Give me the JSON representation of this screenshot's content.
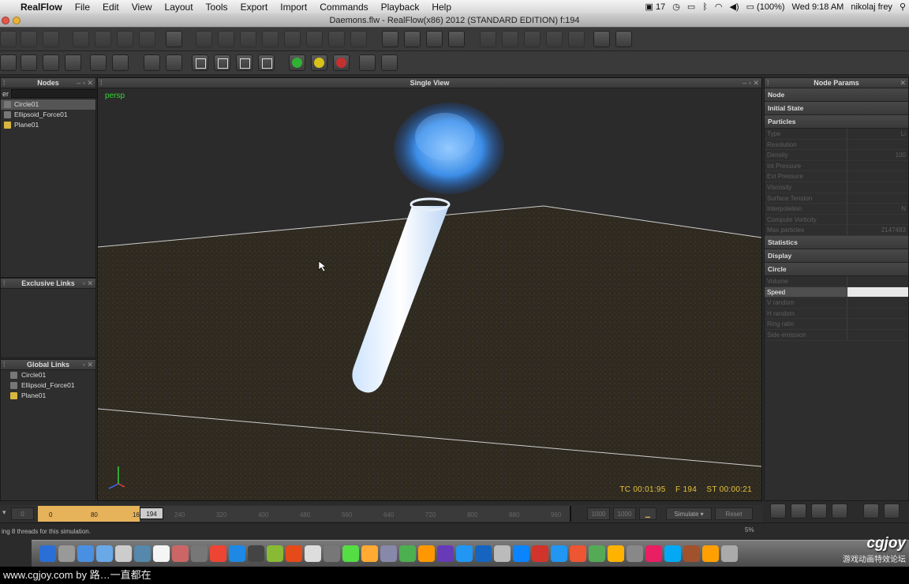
{
  "menubar": {
    "app_name": "RealFlow",
    "items": [
      "File",
      "Edit",
      "View",
      "Layout",
      "Tools",
      "Export",
      "Import",
      "Commands",
      "Playback",
      "Help"
    ],
    "status_badge": "17",
    "battery": "(100%)",
    "clock": "Wed 9:18 AM",
    "user": "nikolaj frey"
  },
  "window": {
    "title": "Daemons.flw - RealFlow(x86) 2012 (STANDARD EDITION) f:194"
  },
  "nodes_panel": {
    "title": "Nodes",
    "search_label": "er",
    "items": [
      {
        "label": "Circle01",
        "icon": "emitter-icon",
        "selected": true
      },
      {
        "label": "Ellipsoid_Force01",
        "icon": "daemon-icon",
        "selected": false
      },
      {
        "label": "Plane01",
        "icon": "object-icon",
        "selected": false
      }
    ]
  },
  "exclusive_links": {
    "title": "Exclusive Links"
  },
  "global_links": {
    "title": "Global Links",
    "items": [
      {
        "label": "Circle01",
        "icon": "emitter-icon"
      },
      {
        "label": "Ellipsoid_Force01",
        "icon": "daemon-icon"
      },
      {
        "label": "Plane01",
        "icon": "object-icon"
      }
    ]
  },
  "viewport": {
    "title": "Single View",
    "camera": "persp",
    "timecode": "TC 00:01:95",
    "frame": "F 194",
    "sim_time": "ST 00:00:21"
  },
  "params": {
    "title": "Node Params",
    "sections": {
      "node": "Node",
      "initial_state": "Initial State",
      "particles": "Particles",
      "statistics": "Statistics",
      "display": "Display",
      "circle": "Circle"
    },
    "particle_rows": [
      {
        "k": "Type",
        "v": "Li"
      },
      {
        "k": "Resolution",
        "v": ""
      },
      {
        "k": "Density",
        "v": "100"
      },
      {
        "k": "Int Pressure",
        "v": ""
      },
      {
        "k": "Ext Pressure",
        "v": ""
      },
      {
        "k": "Viscosity",
        "v": ""
      },
      {
        "k": "Surface Tension",
        "v": ""
      },
      {
        "k": "Interpolation",
        "v": "N"
      },
      {
        "k": "Compute Vorticity",
        "v": ""
      },
      {
        "k": "Max particles",
        "v": "2147483"
      }
    ],
    "circle_rows": [
      {
        "k": "Volume",
        "v": "",
        "selected": false
      },
      {
        "k": "Speed",
        "v": "",
        "selected": true
      },
      {
        "k": "V random",
        "v": "",
        "selected": false
      },
      {
        "k": "H random",
        "v": "",
        "selected": false
      },
      {
        "k": "Ring ratio",
        "v": "",
        "selected": false
      },
      {
        "k": "Side emission",
        "v": "",
        "selected": false
      }
    ]
  },
  "timeline": {
    "start_box": "0",
    "current_frame": "194",
    "ticks": [
      "0",
      "80",
      "160",
      "240",
      "320",
      "400",
      "480",
      "560",
      "640",
      "720",
      "800",
      "880",
      "960"
    ],
    "range_end_a": "1000",
    "range_end_b": "1000",
    "simulate_label": "Simulate",
    "reset_label": "Reset"
  },
  "status": {
    "message": "ing 8 threads for this simulation.",
    "percent": "5%"
  },
  "overlay": {
    "watermark": "www.cgjoy.com by 路…一直都在",
    "logo": "cgjoy",
    "logo_sub": "游戏动画特效论坛"
  }
}
